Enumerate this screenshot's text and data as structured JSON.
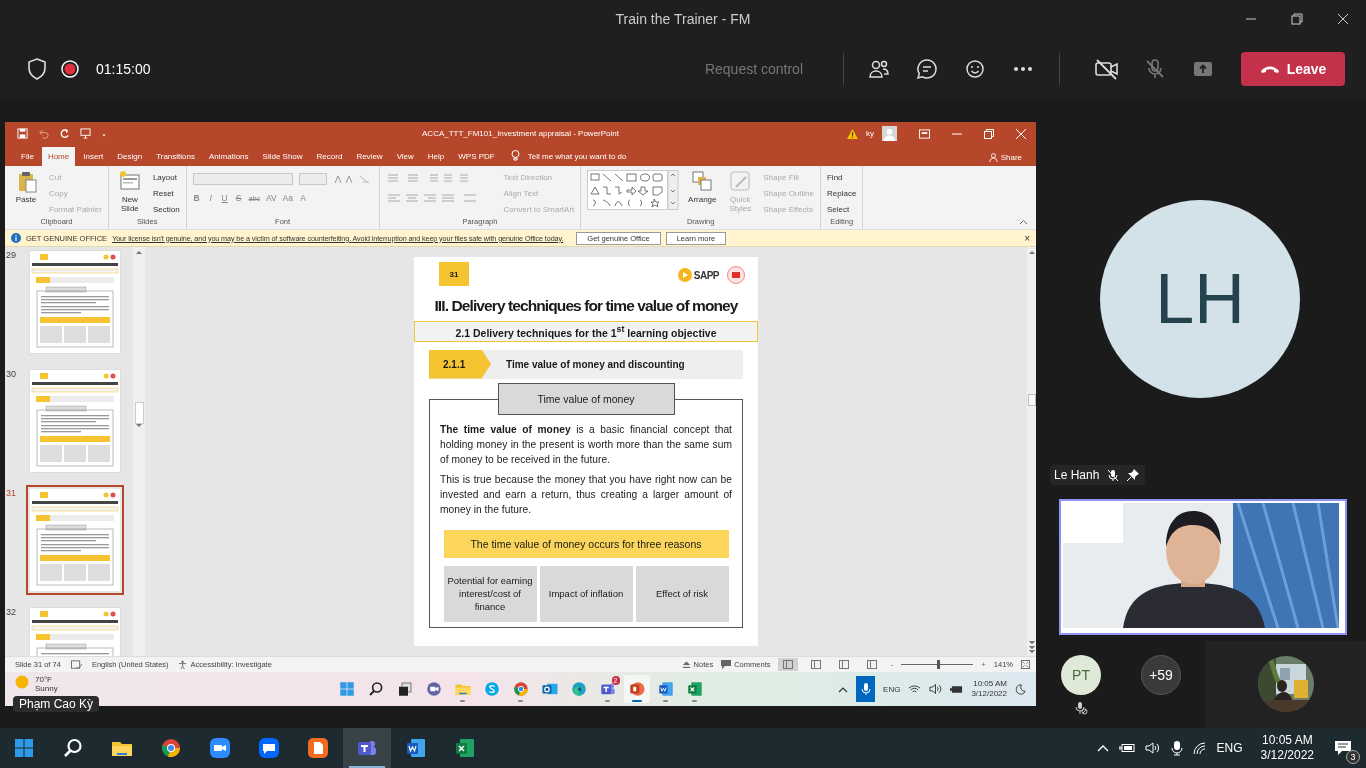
{
  "window": {
    "title": "Train the Trainer - FM"
  },
  "meeting": {
    "recording": true,
    "duration": "01:15:00",
    "request_control": {
      "label": "Request control",
      "disabled": true
    },
    "camera_on": false,
    "mic_on": false,
    "leave": "Leave"
  },
  "shared_screen": {
    "presenter": "Phạm Cao Kỳ",
    "app": {
      "title": "ACCA_TTT_FM101_Investment appraisal  -  PowerPoint",
      "user": "ky",
      "tabs": [
        {
          "label": "File",
          "selected": false
        },
        {
          "label": "Home",
          "selected": true
        },
        {
          "label": "Insert",
          "selected": false
        },
        {
          "label": "Design",
          "selected": false
        },
        {
          "label": "Transitions",
          "selected": false
        },
        {
          "label": "Animations",
          "selected": false
        },
        {
          "label": "Slide Show",
          "selected": false
        },
        {
          "label": "Record",
          "selected": false
        },
        {
          "label": "Review",
          "selected": false
        },
        {
          "label": "View",
          "selected": false
        },
        {
          "label": "Help",
          "selected": false
        },
        {
          "label": "WPS PDF",
          "selected": false
        }
      ],
      "tell_me": "Tell me what you want to do",
      "share": "Share",
      "ribbon": [
        {
          "kind": "clipboard",
          "label": "Clipboard",
          "items": [
            {
              "kind": "large",
              "label": "Paste",
              "disabled": false
            },
            {
              "kind": "small",
              "label": "Cut",
              "disabled": true
            },
            {
              "kind": "small",
              "label": "Copy",
              "disabled": true
            },
            {
              "kind": "small",
              "label": "Format Painter",
              "disabled": true
            }
          ]
        },
        {
          "kind": "slides",
          "label": "Slides",
          "items": [
            {
              "kind": "large",
              "label": "New Slide",
              "disabled": false
            },
            {
              "kind": "small",
              "label": "Layout",
              "disabled": false
            },
            {
              "kind": "small",
              "label": "Reset",
              "disabled": false
            },
            {
              "kind": "small",
              "label": "Section",
              "disabled": false
            }
          ]
        },
        {
          "kind": "font",
          "label": "Font",
          "format": [
            "B",
            "I",
            "U",
            "S",
            "abc",
            "AV",
            "Aa",
            "A"
          ]
        },
        {
          "kind": "paragraph",
          "label": "Paragraph",
          "items": [
            {
              "kind": "small",
              "label": "Text Direction",
              "disabled": true
            },
            {
              "kind": "small",
              "label": "Align Text",
              "disabled": true
            },
            {
              "kind": "small",
              "label": "Convert to SmartArt",
              "disabled": true
            }
          ]
        },
        {
          "kind": "drawing",
          "label": "Drawing",
          "items": [
            {
              "kind": "large",
              "label": "Arrange",
              "disabled": false
            },
            {
              "kind": "large",
              "label": "Quick Styles",
              "disabled": true
            },
            {
              "kind": "small",
              "label": "Shape Fill",
              "disabled": true
            },
            {
              "kind": "small",
              "label": "Shape Outline",
              "disabled": true
            },
            {
              "kind": "small",
              "label": "Shape Effects",
              "disabled": true
            }
          ]
        },
        {
          "kind": "editing",
          "label": "Editing",
          "items": [
            {
              "kind": "small",
              "label": "Find",
              "disabled": false
            },
            {
              "kind": "small",
              "label": "Replace",
              "disabled": false
            },
            {
              "kind": "small",
              "label": "Select",
              "disabled": false
            }
          ]
        }
      ],
      "notice": {
        "title": "GET GENUINE OFFICE",
        "message": "Your license isn't genuine, and you may be a victim of software counterfeiting. Avoid interruption and keep your files safe with genuine Office today.",
        "buttons": [
          "Get genuine Office",
          "Learn more"
        ],
        "close": "×"
      },
      "thumbnails": [
        {
          "number": "29",
          "selected": false
        },
        {
          "number": "30",
          "selected": false
        },
        {
          "number": "31",
          "selected": true
        },
        {
          "number": "32",
          "selected": false
        }
      ],
      "slide": {
        "number": "31",
        "logo": "SAPP",
        "title": "III. Delivery techniques for time value of money",
        "subtitle": "2.1 Delivery techniques for the 1$^{st}$ learning objective",
        "section_number": "2.1.1",
        "section_title": "Time value of money and discounting",
        "box_title": "Time value of money",
        "paragraphs": [
          "**The time value of money** is a basic financial concept that holding money in the present is worth more than the same sum of money to be received in the future.",
          "This is true because the money that you have right now can be invested and earn a return, thus creating a larger amount of money in the future."
        ],
        "callout": "The time value of money occurs for three reasons",
        "reasons": [
          "Potential for earning interest/cost of finance",
          "Impact of inflation",
          "Effect of risk"
        ]
      },
      "status": {
        "slide": "Slide 31 of 74",
        "language": "English (United States)",
        "accessibility": "Accessibility: Investigate",
        "notes": "Notes",
        "comments": "Comments",
        "views": [
          {
            "selected": true
          },
          {
            "selected": false
          },
          {
            "selected": false
          },
          {
            "selected": false
          }
        ],
        "zoom_out": "-",
        "zoom_in": "+",
        "zoom_slider": {
          "level": 0.51
        },
        "zoom": "141%"
      }
    },
    "taskbar": {
      "weather": {
        "temp": "70°F",
        "condition": "Sunny"
      },
      "apps": [
        {
          "kind": "windows",
          "running": false,
          "selected": false
        },
        {
          "kind": "search",
          "running": false,
          "selected": false
        },
        {
          "kind": "taskview",
          "running": false,
          "selected": false
        },
        {
          "kind": "videochat",
          "running": false,
          "selected": false
        },
        {
          "kind": "folder",
          "running": true,
          "selected": false
        },
        {
          "kind": "call",
          "running": false,
          "selected": false
        },
        {
          "kind": "browser",
          "running": true,
          "selected": false
        },
        {
          "kind": "mail",
          "running": false,
          "selected": false
        },
        {
          "kind": "edge",
          "running": false,
          "selected": false
        },
        {
          "kind": "teams",
          "running": true,
          "selected": false,
          "badge": "2"
        },
        {
          "kind": "powerpoint",
          "running": true,
          "selected": true
        },
        {
          "kind": "word",
          "running": true,
          "selected": false
        },
        {
          "kind": "excel",
          "running": true,
          "selected": false
        }
      ],
      "mic_active": true,
      "language": "ENG",
      "time": "10:05 AM",
      "date": "3/12/2022"
    }
  },
  "stage": {
    "initials": "LH"
  },
  "video": {
    "name": "Le Hanh",
    "muted": true,
    "pinned": true
  },
  "participants": [
    {
      "kind": "avatar",
      "initials": "PT",
      "muted": true
    },
    {
      "kind": "count",
      "label": "+59"
    },
    {
      "kind": "picture"
    }
  ],
  "os_taskbar": {
    "apps": [
      {
        "kind": "windows",
        "selected": false
      },
      {
        "kind": "search",
        "selected": false
      },
      {
        "kind": "folder",
        "selected": false
      },
      {
        "kind": "browser",
        "selected": false
      },
      {
        "kind": "video",
        "selected": false
      },
      {
        "kind": "chat",
        "selected": false
      },
      {
        "kind": "pdf",
        "selected": false
      },
      {
        "kind": "teams",
        "selected": true
      },
      {
        "kind": "word",
        "selected": false
      },
      {
        "kind": "excel",
        "selected": false
      }
    ],
    "language": "ENG",
    "time": "10:05 AM",
    "date": "3/12/2022",
    "notifications": "3"
  }
}
